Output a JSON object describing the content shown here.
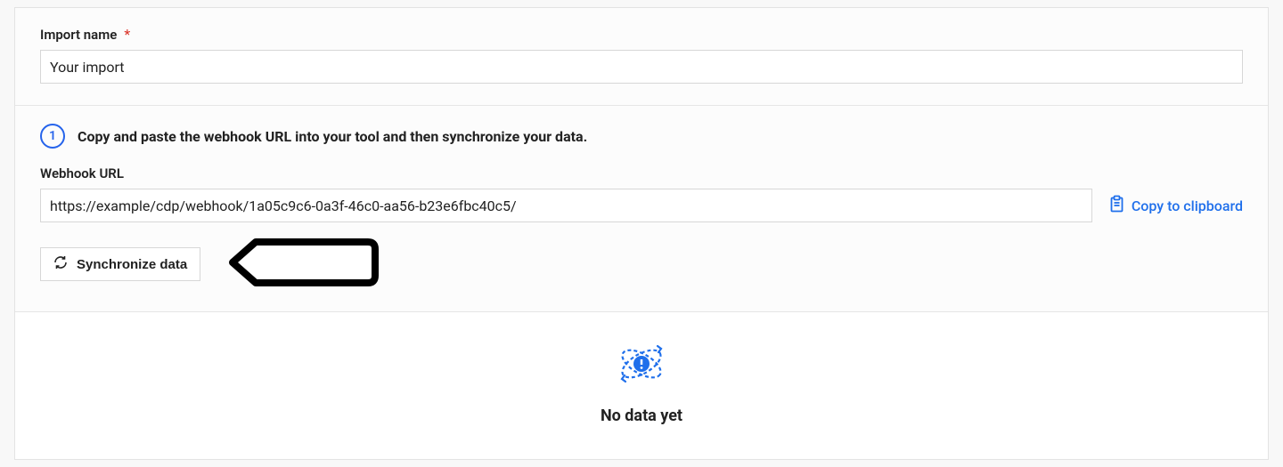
{
  "form": {
    "import_name_label": "Import name",
    "import_name_value": "Your import"
  },
  "step": {
    "number": "1",
    "title": "Copy and paste the webhook URL into your tool and then synchronize your data.",
    "webhook_label": "Webhook URL",
    "webhook_value": "https://example/cdp/webhook/1a05c9c6-0a3f-46c0-aa56-b23e6fbc40c5/",
    "copy_label": "Copy to clipboard",
    "sync_label": "Synchronize data"
  },
  "empty": {
    "title": "No data yet"
  }
}
